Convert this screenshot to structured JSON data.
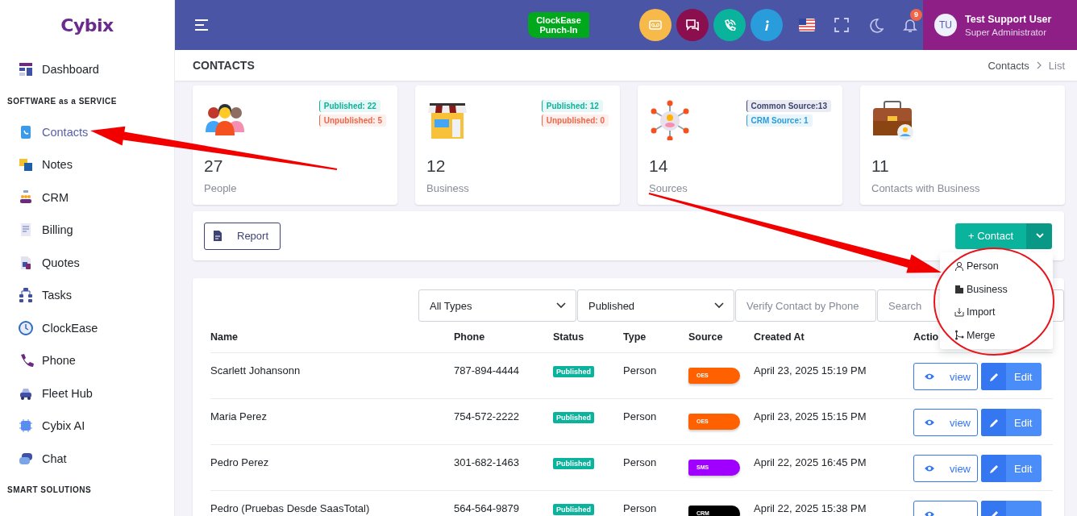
{
  "sidebar": {
    "logo": "Cybix",
    "top_items": [
      {
        "label": "Dashboard",
        "selected": false
      }
    ],
    "sections": [
      {
        "heading": "SOFTWARE as a SERVICE",
        "items": [
          {
            "label": "Contacts",
            "selected": true
          },
          {
            "label": "Notes",
            "selected": false
          },
          {
            "label": "CRM",
            "selected": false
          },
          {
            "label": "Billing",
            "selected": false
          },
          {
            "label": "Quotes",
            "selected": false
          },
          {
            "label": "Tasks",
            "selected": false
          },
          {
            "label": "ClockEase",
            "selected": false
          },
          {
            "label": "Phone",
            "selected": false
          },
          {
            "label": "Fleet Hub",
            "selected": false
          },
          {
            "label": "Cybix AI",
            "selected": false
          },
          {
            "label": "Chat",
            "selected": false
          }
        ]
      },
      {
        "heading": "SMART SOLUTIONS"
      }
    ]
  },
  "topbar": {
    "punch_in_button": "ClockEase Punch-In",
    "notification_count": "9",
    "user": {
      "initials": "TU",
      "name": "Test Support User",
      "role": "Super Administrator"
    }
  },
  "page": {
    "title": "CONTACTS",
    "breadcrumb": [
      "Contacts",
      "List"
    ]
  },
  "cards": [
    {
      "value": "27",
      "label": "People",
      "badges": [
        {
          "text": "Published: 22",
          "color": "#0ab39c"
        },
        {
          "text": "Unpublished: 5",
          "color": "#f06548"
        }
      ]
    },
    {
      "value": "12",
      "label": "Business",
      "badges": [
        {
          "text": "Published: 12",
          "color": "#0ab39c"
        },
        {
          "text": "Unpublished: 0",
          "color": "#f06548"
        }
      ]
    },
    {
      "value": "14",
      "label": "Sources",
      "badges": [
        {
          "text": "Common Source:13",
          "color": "#3d4475"
        },
        {
          "text": "CRM Source: 1",
          "color": "#299cdb"
        }
      ]
    },
    {
      "value": "11",
      "label": "Contacts with Business"
    }
  ],
  "toolbar": {
    "report_button": "Report",
    "add_button": "+ Contact",
    "add_menu": {
      "expanded": true,
      "items": [
        "Person",
        "Business",
        "Import",
        "Merge"
      ]
    }
  },
  "filters": [
    {
      "kind": "select",
      "value": "All Types"
    },
    {
      "kind": "select",
      "value": "Published"
    },
    {
      "kind": "input",
      "placeholder": "Verify Contact by Phone"
    },
    {
      "kind": "input",
      "placeholder": "Search"
    }
  ],
  "table": {
    "columns": [
      "Name",
      "Phone",
      "Status",
      "Type",
      "Source",
      "Created At",
      "Actio"
    ],
    "rows": [
      {
        "name": "Scarlett Johansonn",
        "phone": "787-894-4444",
        "status": "Published",
        "type": "Person",
        "source": {
          "label": "OES",
          "color": "#ff6000"
        },
        "created": "April 23, 2025 15:19 PM",
        "actions": [
          "view",
          "Edit"
        ]
      },
      {
        "name": "Maria Perez",
        "phone": "754-572-2222",
        "status": "Published",
        "type": "Person",
        "source": {
          "label": "OES",
          "color": "#ff6000"
        },
        "created": "April 23, 2025 15:15 PM",
        "actions": [
          "view",
          "Edit"
        ]
      },
      {
        "name": "Pedro Perez",
        "phone": "301-682-1463",
        "status": "Published",
        "type": "Person",
        "source": {
          "label": "SMS",
          "color": "#a000ff"
        },
        "created": "April 22, 2025 16:45 PM",
        "actions": [
          "view",
          "Edit"
        ]
      },
      {
        "name": "Pedro (Pruebas Desde SaasTotal)",
        "phone": "564-564-9879",
        "status": "Published",
        "type": "Person",
        "source": {
          "label": "CRM",
          "color": "#000000"
        },
        "created": "April 22, 2025 15:38 PM"
      }
    ]
  }
}
